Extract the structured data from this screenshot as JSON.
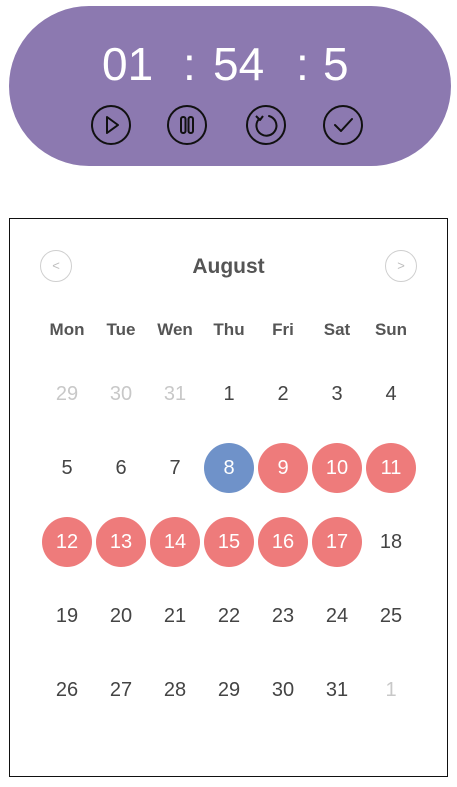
{
  "timer": {
    "hours": "01",
    "minutes": "54",
    "seconds": "5",
    "separator": ":",
    "background": "#8c79b0",
    "controls": [
      {
        "name": "play-button",
        "icon": "play-icon"
      },
      {
        "name": "pause-button",
        "icon": "pause-icon"
      },
      {
        "name": "reset-button",
        "icon": "refresh-icon"
      },
      {
        "name": "done-button",
        "icon": "check-icon"
      }
    ]
  },
  "calendar": {
    "month": "August",
    "prev_label": "<",
    "next_label": ">",
    "weekdays": [
      "Mon",
      "Tue",
      "Wen",
      "Thu",
      "Fri",
      "Sat",
      "Sun"
    ],
    "colors": {
      "selected": "#6f92c9",
      "range": "#ee7b7b",
      "muted": "#c8c8c8"
    },
    "weeks": [
      [
        {
          "d": "29",
          "s": "muted"
        },
        {
          "d": "30",
          "s": "muted"
        },
        {
          "d": "31",
          "s": "muted"
        },
        {
          "d": "1",
          "s": ""
        },
        {
          "d": "2",
          "s": ""
        },
        {
          "d": "3",
          "s": ""
        },
        {
          "d": "4",
          "s": ""
        }
      ],
      [
        {
          "d": "5",
          "s": ""
        },
        {
          "d": "6",
          "s": ""
        },
        {
          "d": "7",
          "s": ""
        },
        {
          "d": "8",
          "s": "today"
        },
        {
          "d": "9",
          "s": "range"
        },
        {
          "d": "10",
          "s": "range"
        },
        {
          "d": "11",
          "s": "range"
        }
      ],
      [
        {
          "d": "12",
          "s": "range"
        },
        {
          "d": "13",
          "s": "range"
        },
        {
          "d": "14",
          "s": "range"
        },
        {
          "d": "15",
          "s": "range"
        },
        {
          "d": "16",
          "s": "range"
        },
        {
          "d": "17",
          "s": "range"
        },
        {
          "d": "18",
          "s": ""
        }
      ],
      [
        {
          "d": "19",
          "s": ""
        },
        {
          "d": "20",
          "s": ""
        },
        {
          "d": "21",
          "s": ""
        },
        {
          "d": "22",
          "s": ""
        },
        {
          "d": "23",
          "s": ""
        },
        {
          "d": "24",
          "s": ""
        },
        {
          "d": "25",
          "s": ""
        }
      ],
      [
        {
          "d": "26",
          "s": ""
        },
        {
          "d": "27",
          "s": ""
        },
        {
          "d": "28",
          "s": ""
        },
        {
          "d": "29",
          "s": ""
        },
        {
          "d": "30",
          "s": ""
        },
        {
          "d": "31",
          "s": ""
        },
        {
          "d": "1",
          "s": "muted"
        }
      ]
    ]
  }
}
